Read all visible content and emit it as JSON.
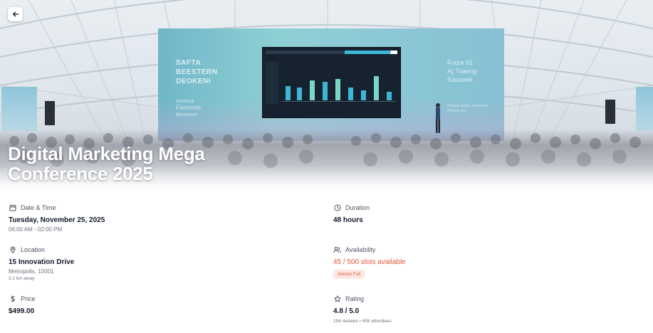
{
  "hero": {
    "title": "Digital Marketing Mega Conference 2025",
    "back_icon": "arrow-left-icon"
  },
  "details": {
    "date_time": {
      "label": "Date & Time",
      "icon": "calendar-icon",
      "value": "Tuesday, November 25, 2025",
      "sub": "06:00 AM - 02:00 PM"
    },
    "duration": {
      "label": "Duration",
      "icon": "clock-icon",
      "value": "48 hours"
    },
    "location": {
      "label": "Location",
      "icon": "map-pin-icon",
      "value": "15 Innovation Drive",
      "sub": "Metropolis, 10001",
      "distance": "2.1 km away"
    },
    "availability": {
      "label": "Availability",
      "icon": "users-icon",
      "value": "45 / 500 slots available",
      "badge": "Almost Full"
    },
    "price": {
      "label": "Price",
      "icon": "dollar-icon",
      "value": "$499.00"
    },
    "rating": {
      "label": "Rating",
      "icon": "star-icon",
      "value": "4.8 / 5.0",
      "sub": "154 reviews • 455 attendees"
    }
  },
  "colors": {
    "accent": "#e1553d",
    "badge_bg": "#fde6e2"
  }
}
